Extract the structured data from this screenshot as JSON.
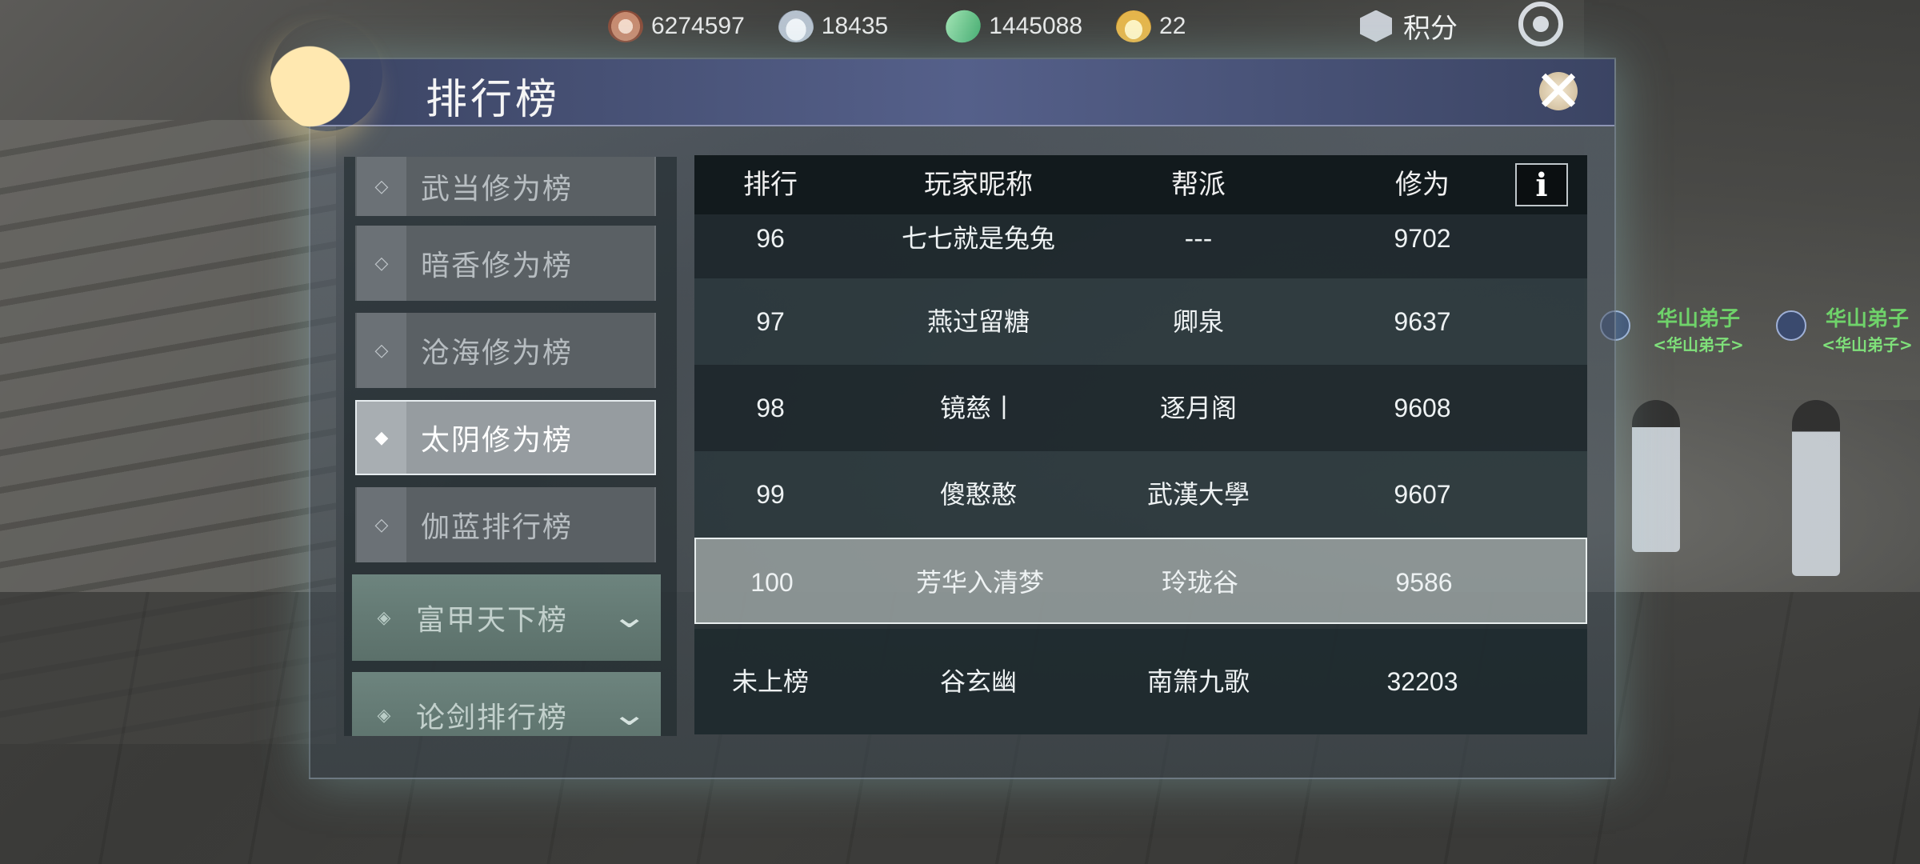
{
  "currencies": [
    {
      "icon": "coin-icon",
      "value": "6274597"
    },
    {
      "icon": "silver-ingot-plus-icon",
      "value": "18435"
    },
    {
      "icon": "jade-plus-icon",
      "value": "1445088"
    },
    {
      "icon": "gold-ingot-plus-icon",
      "value": "22"
    }
  ],
  "score_label": "积分",
  "panel": {
    "title": "排行榜"
  },
  "nav": {
    "items": [
      {
        "label": "武当修为榜",
        "active": false
      },
      {
        "label": "暗香修为榜",
        "active": false
      },
      {
        "label": "沧海修为榜",
        "active": false
      },
      {
        "label": "太阴修为榜",
        "active": true
      },
      {
        "label": "伽蓝排行榜",
        "active": false
      }
    ],
    "groups": [
      {
        "label": "富甲天下榜"
      },
      {
        "label": "论剑排行榜"
      }
    ]
  },
  "table": {
    "headers": {
      "rank": "排行",
      "name": "玩家昵称",
      "guild": "帮派",
      "score": "修为"
    },
    "info_label": "i",
    "rows": [
      {
        "rank": "96",
        "name": "七七就是兔兔",
        "guild": "---",
        "score": "9702"
      },
      {
        "rank": "97",
        "name": "燕过留糖",
        "guild": "卿泉",
        "score": "9637"
      },
      {
        "rank": "98",
        "name": "镜慈丨",
        "guild": "逐月阁",
        "score": "9608"
      },
      {
        "rank": "99",
        "name": "傻憨憨",
        "guild": "武漢大學",
        "score": "9607"
      },
      {
        "rank": "100",
        "name": "芳华入清梦",
        "guild": "玲珑谷",
        "score": "9586"
      }
    ],
    "self_row": {
      "rank": "未上榜",
      "name": "谷玄幽",
      "guild": "南箫九歌",
      "score": "32203"
    }
  },
  "npcs": [
    {
      "title": "华山弟子",
      "subtitle": "<华山弟子>"
    },
    {
      "title": "华山弟子",
      "subtitle": "<华山弟子>"
    }
  ]
}
